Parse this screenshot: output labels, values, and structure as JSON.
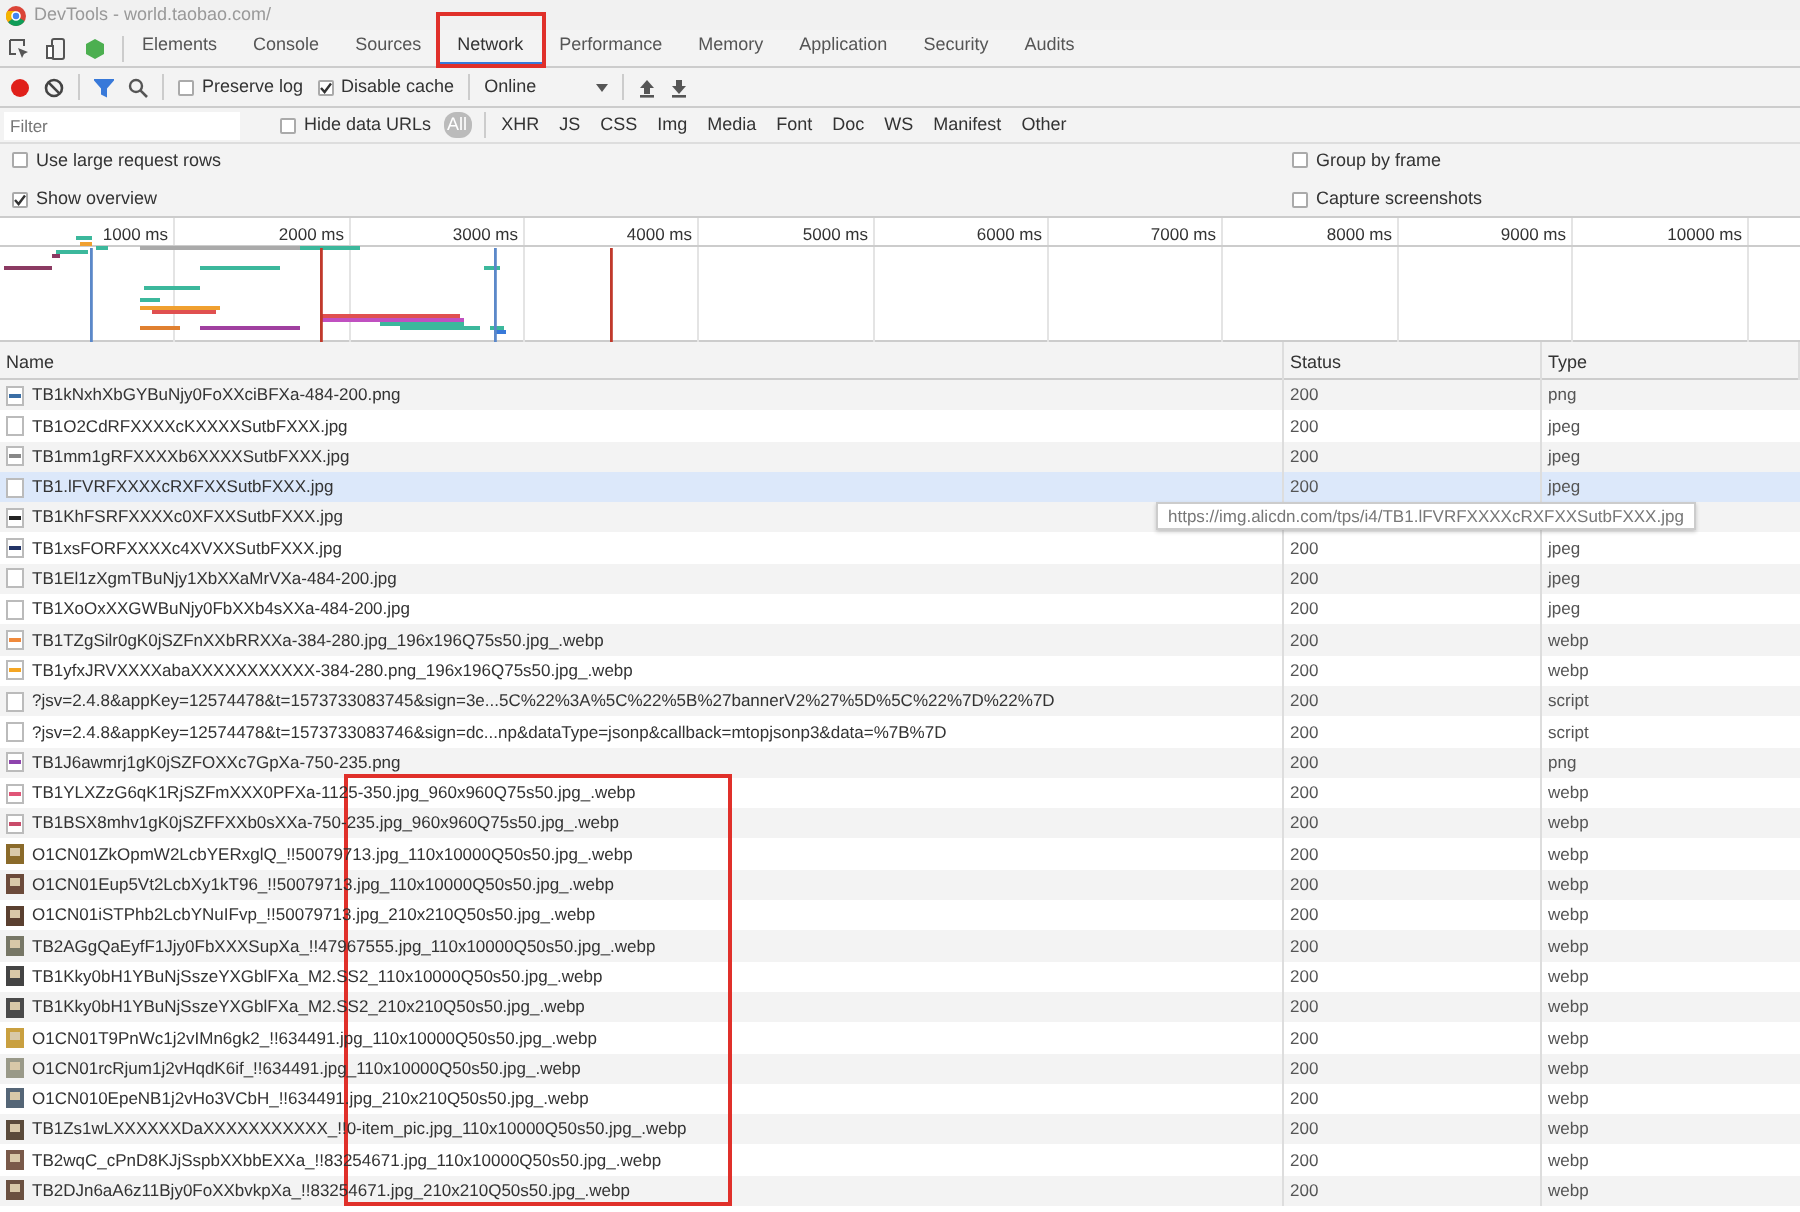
{
  "window": {
    "title": "DevTools - world.taobao.com/"
  },
  "tabs": [
    {
      "label": "Elements",
      "selected": false,
      "annotated": false
    },
    {
      "label": "Console",
      "selected": false,
      "annotated": false
    },
    {
      "label": "Sources",
      "selected": false,
      "annotated": false
    },
    {
      "label": "Network",
      "selected": true,
      "annotated": true
    },
    {
      "label": "Performance",
      "selected": false,
      "annotated": false
    },
    {
      "label": "Memory",
      "selected": false,
      "annotated": false
    },
    {
      "label": "Application",
      "selected": false,
      "annotated": false
    },
    {
      "label": "Security",
      "selected": false,
      "annotated": false
    },
    {
      "label": "Audits",
      "selected": false,
      "annotated": false
    }
  ],
  "toolbar": {
    "recording": true,
    "filter_active": true,
    "preserve_log": {
      "label": "Preserve log",
      "checked": false
    },
    "disable_cache": {
      "label": "Disable cache",
      "checked": true
    },
    "throttling": "Online"
  },
  "filter_bar": {
    "placeholder": "Filter",
    "hide_data_urls": {
      "label": "Hide data URLs",
      "checked": false
    },
    "types": [
      {
        "label": "All",
        "selected": true
      },
      {
        "label": "XHR",
        "selected": false
      },
      {
        "label": "JS",
        "selected": false
      },
      {
        "label": "CSS",
        "selected": false
      },
      {
        "label": "Img",
        "selected": false
      },
      {
        "label": "Media",
        "selected": false
      },
      {
        "label": "Font",
        "selected": false
      },
      {
        "label": "Doc",
        "selected": false
      },
      {
        "label": "WS",
        "selected": false
      },
      {
        "label": "Manifest",
        "selected": false
      },
      {
        "label": "Other",
        "selected": false
      }
    ]
  },
  "settings": [
    {
      "label": "Use large request rows",
      "checked": false
    },
    {
      "label": "Group by frame",
      "checked": false
    },
    {
      "label": "Show overview",
      "checked": true
    },
    {
      "label": "Capture screenshots",
      "checked": false
    }
  ],
  "overview": {
    "ticks": [
      "1000 ms",
      "2000 ms",
      "3000 ms",
      "4000 ms",
      "5000 ms",
      "6000 ms",
      "7000 ms",
      "8000 ms",
      "9000 ms",
      "10000 ms"
    ]
  },
  "table": {
    "columns": [
      "Name",
      "Status",
      "Type"
    ],
    "annotation_box": true,
    "rows": [
      {
        "name": "TB1kNxhXbGYBuNjy0FoXXciBFXa-484-200.png",
        "status": "200",
        "type": "png",
        "kind": "line",
        "color": "#3a6ea5",
        "hovered": false
      },
      {
        "name": "TB1O2CdRFXXXXcKXXXXSutbFXXX.jpg",
        "status": "200",
        "type": "jpeg",
        "kind": "blank",
        "hovered": false
      },
      {
        "name": "TB1mm1gRFXXXXb6XXXXSutbFXXX.jpg",
        "status": "200",
        "type": "jpeg",
        "kind": "line",
        "color": "#888888",
        "hovered": false
      },
      {
        "name": "TB1.lFVRFXXXXcRXFXXSutbFXXX.jpg",
        "status": "200",
        "type": "jpeg",
        "kind": "blank",
        "hovered": true
      },
      {
        "name": "TB1KhFSRFXXXXc0XFXXSutbFXXX.jpg",
        "kind": "line",
        "color": "#222222",
        "hovered": false
      },
      {
        "name": "TB1xsFORFXXXXc4XVXXSutbFXXX.jpg",
        "status": "200",
        "type": "jpeg",
        "kind": "line",
        "color": "#223366",
        "hovered": false
      },
      {
        "name": "TB1El1zXgmTBuNjy1XbXXaMrVXa-484-200.jpg",
        "status": "200",
        "type": "jpeg",
        "kind": "blank",
        "hovered": false
      },
      {
        "name": "TB1XoOxXXGWBuNjy0FbXXb4sXXa-484-200.jpg",
        "status": "200",
        "type": "jpeg",
        "kind": "blank",
        "hovered": false
      },
      {
        "name": "TB1TZgSilr0gK0jSZFnXXbRRXXa-384-280.jpg_196x196Q75s50.jpg_.webp",
        "status": "200",
        "type": "webp",
        "kind": "line",
        "color": "#f08a3c",
        "hovered": false
      },
      {
        "name": "TB1yfxJRVXXXXabaXXXXXXXXXXX-384-280.png_196x196Q75s50.jpg_.webp",
        "status": "200",
        "type": "webp",
        "kind": "line",
        "color": "#f5a623",
        "hovered": false
      },
      {
        "name": "?jsv=2.4.8&appKey=12574478&t=1573733083745&sign=3e...5C%22%3A%5C%22%5B%27bannerV2%27%5D%5C%22%7D%22%7D",
        "status": "200",
        "type": "script",
        "kind": "blank",
        "hovered": false
      },
      {
        "name": "?jsv=2.4.8&appKey=12574478&t=1573733083746&sign=dc...np&dataType=jsonp&callback=mtopjsonp3&data=%7B%7D",
        "status": "200",
        "type": "script",
        "kind": "blank",
        "hovered": false
      },
      {
        "name": "TB1J6awmrj1gK0jSZFOXXc7GpXa-750-235.png",
        "status": "200",
        "type": "png",
        "kind": "line",
        "color": "#8e44ad",
        "hovered": false
      },
      {
        "name": "TB1YLXZzG6qK1RjSZFmXXX0PFXa-1125-350.jpg_960x960Q75s50.jpg_.webp",
        "status": "200",
        "type": "webp",
        "kind": "line",
        "color": "#e05577",
        "hovered": false
      },
      {
        "name": "TB1BSX8mhv1gK0jSZFFXXb0sXXa-750-235.jpg_960x960Q75s50.jpg_.webp",
        "status": "200",
        "type": "webp",
        "kind": "line",
        "color": "#c94c6a",
        "hovered": false
      },
      {
        "name": "O1CN01ZkOpmW2LcbYERxglQ_!!50079713.jpg_110x10000Q50s50.jpg_.webp",
        "status": "200",
        "type": "webp",
        "kind": "thumb",
        "color": "#8a6a2a",
        "hovered": false
      },
      {
        "name": "O1CN01Eup5Vt2LcbXy1kT96_!!50079713.jpg_110x10000Q50s50.jpg_.webp",
        "status": "200",
        "type": "webp",
        "kind": "thumb",
        "color": "#6b4a3a",
        "hovered": false
      },
      {
        "name": "O1CN01iSTPhb2LcbYNuIFvp_!!50079713.jpg_210x210Q50s50.jpg_.webp",
        "status": "200",
        "type": "webp",
        "kind": "thumb",
        "color": "#5a4030",
        "hovered": false
      },
      {
        "name": "TB2AGgQaEyfF1Jjy0FbXXXSupXa_!!47967555.jpg_110x10000Q50s50.jpg_.webp",
        "status": "200",
        "type": "webp",
        "kind": "thumb",
        "color": "#777766",
        "hovered": false
      },
      {
        "name": "TB1Kky0bH1YBuNjSszeYXGblFXa_M2.SS2_110x10000Q50s50.jpg_.webp",
        "status": "200",
        "type": "webp",
        "kind": "thumb",
        "color": "#444444",
        "hovered": false
      },
      {
        "name": "TB1Kky0bH1YBuNjSszeYXGblFXa_M2.SS2_210x210Q50s50.jpg_.webp",
        "status": "200",
        "type": "webp",
        "kind": "thumb",
        "color": "#4a4a4a",
        "hovered": false
      },
      {
        "name": "O1CN01T9PnWc1j2vIMn6gk2_!!634491.jpg_110x10000Q50s50.jpg_.webp",
        "status": "200",
        "type": "webp",
        "kind": "thumb",
        "color": "#c9a040",
        "hovered": false
      },
      {
        "name": "O1CN01rcRjum1j2vHqdK6if_!!634491.jpg_110x10000Q50s50.jpg_.webp",
        "status": "200",
        "type": "webp",
        "kind": "thumb",
        "color": "#999988",
        "hovered": false
      },
      {
        "name": "O1CN010EpeNB1j2vHo3VCbH_!!634491.jpg_210x210Q50s50.jpg_.webp",
        "status": "200",
        "type": "webp",
        "kind": "thumb",
        "color": "#556677",
        "hovered": false
      },
      {
        "name": "TB1Zs1wLXXXXXXDaXXXXXXXXXXX_!!0-item_pic.jpg_110x10000Q50s50.jpg_.webp",
        "status": "200",
        "type": "webp",
        "kind": "thumb",
        "color": "#5a4a3a",
        "hovered": false
      },
      {
        "name": "TB2wqC_cPnD8KJjSspbXXbbEXXa_!!83254671.jpg_110x10000Q50s50.jpg_.webp",
        "status": "200",
        "type": "webp",
        "kind": "thumb",
        "color": "#7a5a4a",
        "hovered": false
      },
      {
        "name": "TB2DJn6aA6z11Bjy0FoXXbvkpXa_!!83254671.jpg_210x210Q50s50.jpg_.webp",
        "status": "200",
        "type": "webp",
        "kind": "thumb",
        "color": "#6a5040",
        "hovered": false
      }
    ]
  },
  "tooltip": "https://img.alicdn.com/tps/i4/TB1.lFVRFXXXXcRXFXXSutbFXXX.jpg"
}
